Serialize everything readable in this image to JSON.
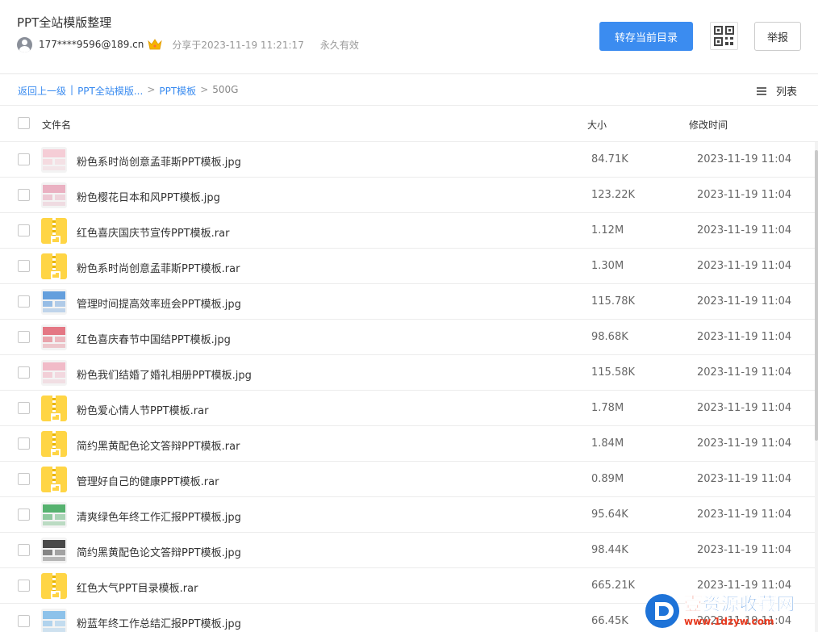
{
  "header": {
    "title": "PPT全站模版整理",
    "user": "177****9596@189.cn",
    "share_time": "分享于2023-11-19 11:21:17",
    "expiry": "永久有效",
    "save_button": "转存当前目录",
    "report_button": "举报"
  },
  "breadcrumb": {
    "back": "返回上一级",
    "sep1": "|",
    "item1": "PPT全站模版...",
    "sep2": ">",
    "item2": "PPT模板",
    "sep3": ">",
    "current": "500G"
  },
  "view_mode": "列表",
  "table": {
    "col_name": "文件名",
    "col_size": "大小",
    "col_time": "修改时间"
  },
  "files": [
    {
      "name": "粉色系时尚创意孟菲斯PPT模板.jpg",
      "size": "84.71K",
      "time": "2023-11-19 11:04",
      "type": "jpg"
    },
    {
      "name": "粉色樱花日本和风PPT模板.jpg",
      "size": "123.22K",
      "time": "2023-11-19 11:04",
      "type": "jpg"
    },
    {
      "name": "红色喜庆国庆节宣传PPT模板.rar",
      "size": "1.12M",
      "time": "2023-11-19 11:04",
      "type": "rar"
    },
    {
      "name": "粉色系时尚创意孟菲斯PPT模板.rar",
      "size": "1.30M",
      "time": "2023-11-19 11:04",
      "type": "rar"
    },
    {
      "name": "管理时间提高效率班会PPT模板.jpg",
      "size": "115.78K",
      "time": "2023-11-19 11:04",
      "type": "jpg"
    },
    {
      "name": "红色喜庆春节中国结PPT模板.jpg",
      "size": "98.68K",
      "time": "2023-11-19 11:04",
      "type": "jpg"
    },
    {
      "name": "粉色我们结婚了婚礼相册PPT模板.jpg",
      "size": "115.58K",
      "time": "2023-11-19 11:04",
      "type": "jpg"
    },
    {
      "name": "粉色爱心情人节PPT模板.rar",
      "size": "1.78M",
      "time": "2023-11-19 11:04",
      "type": "rar"
    },
    {
      "name": "简约黑黄配色论文答辩PPT模板.rar",
      "size": "1.84M",
      "time": "2023-11-19 11:04",
      "type": "rar"
    },
    {
      "name": "管理好自己的健康PPT模板.rar",
      "size": "0.89M",
      "time": "2023-11-19 11:04",
      "type": "rar"
    },
    {
      "name": "清爽绿色年终工作汇报PPT模板.jpg",
      "size": "95.64K",
      "time": "2023-11-19 11:04",
      "type": "jpg"
    },
    {
      "name": "简约黑黄配色论文答辩PPT模板.jpg",
      "size": "98.44K",
      "time": "2023-11-19 11:04",
      "type": "jpg"
    },
    {
      "name": "红色大气PPT目录模板.rar",
      "size": "665.21K",
      "time": "2023-11-19 11:04",
      "type": "rar"
    },
    {
      "name": "粉蓝年终工作总结汇报PPT模板.jpg",
      "size": "66.45K",
      "time": "2023-11-19 11:04",
      "type": "jpg"
    }
  ],
  "thumb_colors": [
    "#f5c6d0",
    "#e8a4b8",
    "#ffd545",
    "#ffd545",
    "#4a8fd8",
    "#e06070",
    "#f0b0c0",
    "#ffd545",
    "#ffd545",
    "#ffd545",
    "#3aa657",
    "#2a2a2a",
    "#ffd545",
    "#7ab8e8"
  ],
  "watermark": {
    "logo_char": "壹",
    "main": "资源收藏网",
    "url": "www.1dzyw.com"
  }
}
